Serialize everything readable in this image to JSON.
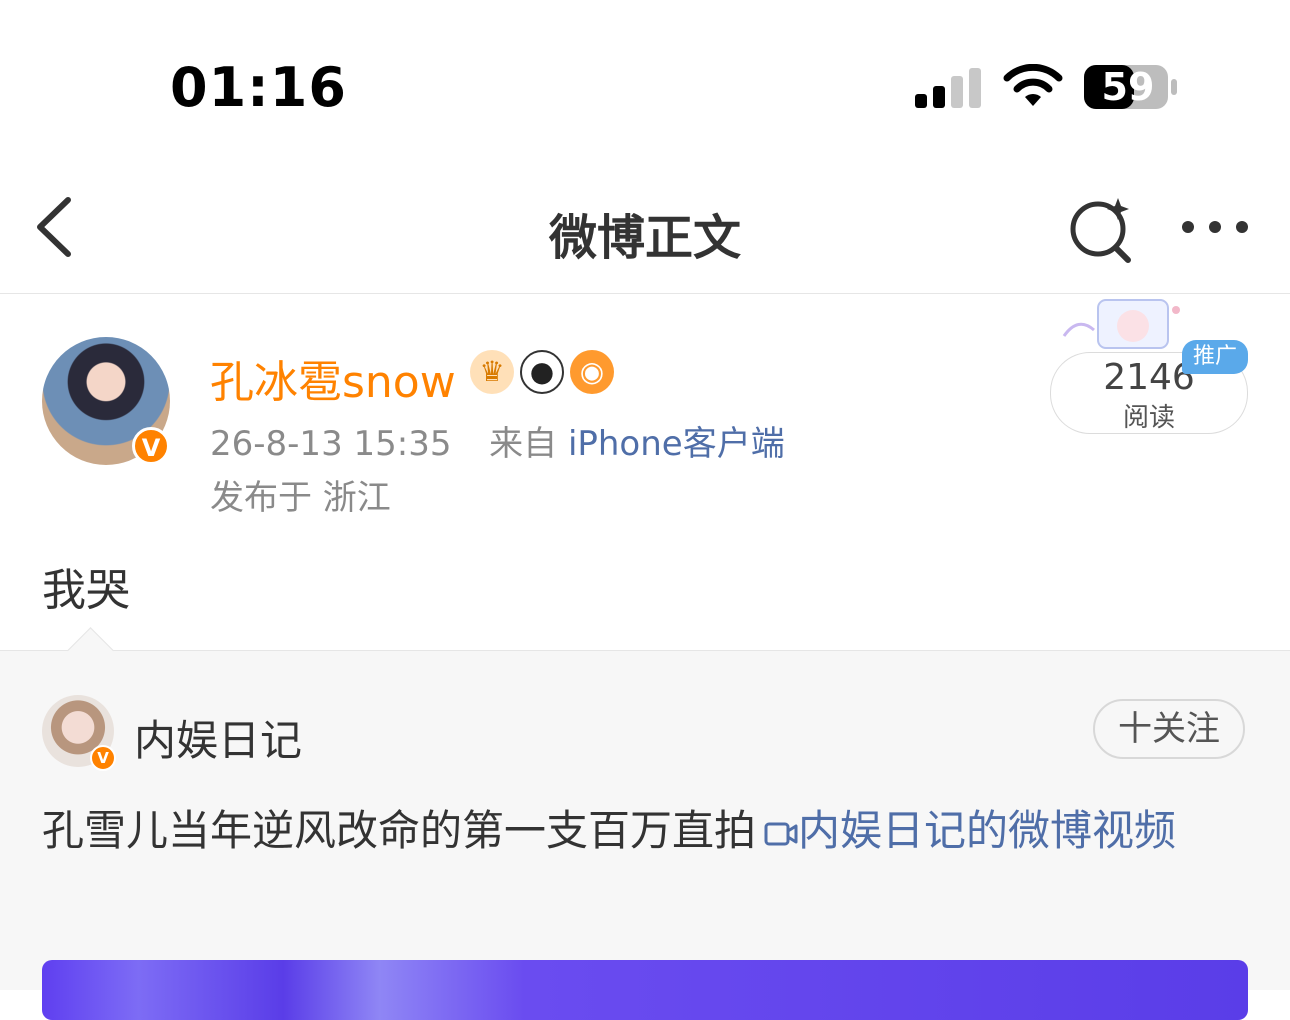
{
  "status_bar": {
    "time": "01:16",
    "battery": "59"
  },
  "nav": {
    "title": "微博正文"
  },
  "post": {
    "author": "孔冰雹snow",
    "badges": [
      "crown-icon",
      "panda-icon",
      "fish-icon"
    ],
    "avatar_badge": "V",
    "date": "26-8-13 15:35",
    "source_prefix": "来自",
    "source": "iPhone客户端",
    "location": "发布于 浙江",
    "read_count": "2146",
    "read_label": "阅读",
    "promo_label": "推广",
    "text": "我哭"
  },
  "repost": {
    "author": "内娱日记",
    "avatar_badge": "V",
    "follow_label": "十关注",
    "text": "孔雪儿当年逆风改命的第一支百万直拍",
    "video_link": "内娱日记的微博视频"
  },
  "colors": {
    "accent": "#ff8200",
    "link": "#4f6ea8",
    "promo": "#5aa9ea"
  }
}
